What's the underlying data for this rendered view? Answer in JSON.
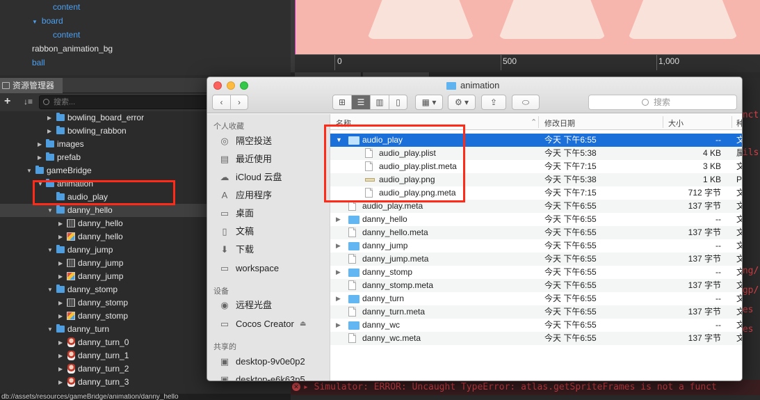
{
  "hierarchy": {
    "items": [
      {
        "label": "content",
        "arrow": ""
      },
      {
        "label": "board",
        "arrow": "▼"
      },
      {
        "label": "content",
        "arrow": ""
      },
      {
        "label": "rabbon_animation_bg",
        "arrow": ""
      },
      {
        "label": "ball",
        "arrow": ""
      }
    ]
  },
  "scene": {
    "ruler": [
      "0",
      "500",
      "1,000"
    ]
  },
  "assets": {
    "title": "资源管理器",
    "search_placeholder": "搜索...",
    "tree": [
      {
        "label": "bowling_board_error",
        "icon": "folder",
        "arrow": "▶"
      },
      {
        "label": "bowling_rabbon",
        "icon": "folder",
        "arrow": "▶"
      },
      {
        "label": "images",
        "icon": "folder",
        "arrow": "▶"
      },
      {
        "label": "prefab",
        "icon": "folder",
        "arrow": "▶"
      },
      {
        "label": "gameBridge",
        "icon": "folder",
        "arrow": "▼"
      },
      {
        "label": "animation",
        "icon": "folder",
        "arrow": "▼"
      },
      {
        "label": "audio_play",
        "icon": "folder",
        "arrow": ""
      },
      {
        "label": "danny_hello",
        "icon": "folder",
        "arrow": "▼"
      },
      {
        "label": "danny_hello",
        "icon": "atlas",
        "arrow": "▶"
      },
      {
        "label": "danny_hello",
        "icon": "texture",
        "arrow": "▶"
      },
      {
        "label": "danny_jump",
        "icon": "folder",
        "arrow": "▼"
      },
      {
        "label": "danny_jump",
        "icon": "atlas",
        "arrow": "▶"
      },
      {
        "label": "danny_jump",
        "icon": "texture",
        "arrow": "▶"
      },
      {
        "label": "danny_stomp",
        "icon": "folder",
        "arrow": "▼"
      },
      {
        "label": "danny_stomp",
        "icon": "atlas",
        "arrow": "▶"
      },
      {
        "label": "danny_stomp",
        "icon": "texture",
        "arrow": "▶"
      },
      {
        "label": "danny_turn",
        "icon": "folder",
        "arrow": "▼"
      },
      {
        "label": "danny_turn_0",
        "icon": "sprite",
        "arrow": "▶"
      },
      {
        "label": "danny_turn_1",
        "icon": "sprite",
        "arrow": "▶"
      },
      {
        "label": "danny_turn_2",
        "icon": "sprite",
        "arrow": "▶"
      },
      {
        "label": "danny_turn_3",
        "icon": "sprite",
        "arrow": "▶"
      }
    ],
    "status": "db://assets/resources/gameBridge/animation/danny_hello"
  },
  "console": {
    "fragments": [
      "unct",
      "ails:",
      "ong/",
      "ngp/",
      "ues",
      "Res"
    ],
    "error_line": "Simulator: ERROR: Uncaught TypeError: atlas.getSpriteFrames is not a funct"
  },
  "finder": {
    "title": "animation",
    "search_placeholder": "搜索",
    "sidebar": {
      "favorites_header": "个人收藏",
      "favorites": [
        {
          "label": "隔空投送",
          "icon": "airdrop-icon"
        },
        {
          "label": "最近使用",
          "icon": "recents-icon"
        },
        {
          "label": "iCloud 云盘",
          "icon": "icloud-icon"
        },
        {
          "label": "应用程序",
          "icon": "applications-icon"
        },
        {
          "label": "桌面",
          "icon": "desktop-icon"
        },
        {
          "label": "文稿",
          "icon": "documents-icon"
        },
        {
          "label": "下载",
          "icon": "downloads-icon"
        },
        {
          "label": "workspace",
          "icon": "folder-icon"
        }
      ],
      "devices_header": "设备",
      "devices": [
        {
          "label": "远程光盘",
          "icon": "disc-icon"
        },
        {
          "label": "Cocos Creator",
          "icon": "drive-icon"
        }
      ],
      "shared_header": "共享的",
      "shared": [
        {
          "label": "desktop-9v0e0p2",
          "icon": "computer-icon"
        },
        {
          "label": "desktop-e6k63p5",
          "icon": "computer-icon"
        }
      ]
    },
    "columns": {
      "name": "名称",
      "date": "修改日期",
      "size": "大小",
      "kind": "种"
    },
    "rows": [
      {
        "name": "audio_play",
        "type": "folder",
        "expanded": true,
        "indent": 0,
        "date": "今天 下午6:55",
        "size": "--",
        "kind": "文"
      },
      {
        "name": "audio_play.plist",
        "type": "doc",
        "indent": 1,
        "date": "今天 下午5:38",
        "size": "4 KB",
        "kind": "属"
      },
      {
        "name": "audio_play.plist.meta",
        "type": "doc",
        "indent": 1,
        "date": "今天 下午7:15",
        "size": "3 KB",
        "kind": "文"
      },
      {
        "name": "audio_play.png",
        "type": "png",
        "indent": 1,
        "date": "今天 下午5:38",
        "size": "1 KB",
        "kind": "Pl"
      },
      {
        "name": "audio_play.png.meta",
        "type": "doc",
        "indent": 1,
        "date": "今天 下午7:15",
        "size": "712 字节",
        "kind": "文"
      },
      {
        "name": "audio_play.meta",
        "type": "doc",
        "indent": 0,
        "date": "今天 下午6:55",
        "size": "137 字节",
        "kind": "文"
      },
      {
        "name": "danny_hello",
        "type": "folder",
        "indent": 0,
        "date": "今天 下午6:55",
        "size": "--",
        "kind": "文"
      },
      {
        "name": "danny_hello.meta",
        "type": "doc",
        "indent": 0,
        "date": "今天 下午6:55",
        "size": "137 字节",
        "kind": "文"
      },
      {
        "name": "danny_jump",
        "type": "folder",
        "indent": 0,
        "date": "今天 下午6:55",
        "size": "--",
        "kind": "文"
      },
      {
        "name": "danny_jump.meta",
        "type": "doc",
        "indent": 0,
        "date": "今天 下午6:55",
        "size": "137 字节",
        "kind": "文"
      },
      {
        "name": "danny_stomp",
        "type": "folder",
        "indent": 0,
        "date": "今天 下午6:55",
        "size": "--",
        "kind": "文"
      },
      {
        "name": "danny_stomp.meta",
        "type": "doc",
        "indent": 0,
        "date": "今天 下午6:55",
        "size": "137 字节",
        "kind": "文"
      },
      {
        "name": "danny_turn",
        "type": "folder",
        "indent": 0,
        "date": "今天 下午6:55",
        "size": "--",
        "kind": "文"
      },
      {
        "name": "danny_turn.meta",
        "type": "doc",
        "indent": 0,
        "date": "今天 下午6:55",
        "size": "137 字节",
        "kind": "文"
      },
      {
        "name": "danny_wc",
        "type": "folder",
        "indent": 0,
        "date": "今天 下午6:55",
        "size": "--",
        "kind": "文"
      },
      {
        "name": "danny_wc.meta",
        "type": "doc",
        "indent": 0,
        "date": "今天 下午6:55",
        "size": "137 字节",
        "kind": "文"
      }
    ]
  },
  "colors": {
    "highlight": "#ff2a17",
    "selection": "#1a6fd9",
    "cocos_link": "#4ea0ef",
    "error": "#e0434b"
  }
}
